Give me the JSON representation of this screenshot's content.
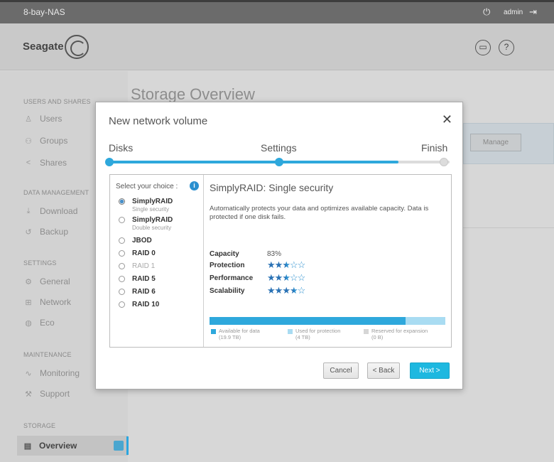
{
  "topbar": {
    "device_name": "8-bay-NAS",
    "user": "admin"
  },
  "header": {
    "brand": "Seagate"
  },
  "sidebar": {
    "sections": [
      {
        "title": "USERS AND SHARES",
        "items": [
          {
            "label": "Users",
            "icon": "user-icon"
          },
          {
            "label": "Groups",
            "icon": "group-icon"
          },
          {
            "label": "Shares",
            "icon": "share-icon"
          }
        ]
      },
      {
        "title": "DATA MANAGEMENT",
        "items": [
          {
            "label": "Download",
            "icon": "download-icon"
          },
          {
            "label": "Backup",
            "icon": "backup-icon"
          }
        ]
      },
      {
        "title": "SETTINGS",
        "items": [
          {
            "label": "General",
            "icon": "gear-icon"
          },
          {
            "label": "Network",
            "icon": "network-icon"
          },
          {
            "label": "Eco",
            "icon": "eco-icon"
          }
        ]
      },
      {
        "title": "MAINTENANCE",
        "items": [
          {
            "label": "Monitoring",
            "icon": "monitoring-icon"
          },
          {
            "label": "Support",
            "icon": "wrench-icon"
          }
        ]
      },
      {
        "title": "STORAGE",
        "items": [
          {
            "label": "Overview",
            "icon": "storage-icon",
            "active": true
          }
        ]
      }
    ]
  },
  "main": {
    "title": "Storage Overview",
    "manage_label": "Manage"
  },
  "modal": {
    "title": "New network volume",
    "steps": [
      "Disks",
      "Settings",
      "Finish"
    ],
    "progress_fraction": 0.85,
    "choices_header": "Select your choice :",
    "options": [
      {
        "label": "SimplyRAID",
        "sub": "Single security",
        "selected": true,
        "disabled": false
      },
      {
        "label": "SimplyRAID",
        "sub": "Double security",
        "selected": false,
        "disabled": false
      },
      {
        "label": "JBOD",
        "sub": "",
        "selected": false,
        "disabled": false
      },
      {
        "label": "RAID 0",
        "sub": "",
        "selected": false,
        "disabled": false
      },
      {
        "label": "RAID 1",
        "sub": "",
        "selected": false,
        "disabled": true
      },
      {
        "label": "RAID 5",
        "sub": "",
        "selected": false,
        "disabled": false
      },
      {
        "label": "RAID 6",
        "sub": "",
        "selected": false,
        "disabled": false
      },
      {
        "label": "RAID 10",
        "sub": "",
        "selected": false,
        "disabled": false
      }
    ],
    "detail": {
      "title": "SimplyRAID: Single security",
      "description": "Automatically protects your data and optimizes available capacity. Data is protected if one disk fails.",
      "metrics": [
        {
          "label": "Capacity",
          "value": "83%"
        },
        {
          "label": "Protection",
          "stars": 2.5
        },
        {
          "label": "Performance",
          "stars": 2.5
        },
        {
          "label": "Scalability",
          "stars": 3.5
        }
      ],
      "capacity_used_fraction": 0.83,
      "legend": [
        {
          "label": "Available for data",
          "value": "(19.9 TB)",
          "color": "#2ea8dc"
        },
        {
          "label": "Used for protection",
          "value": "(4 TB)",
          "color": "#a9dcf2"
        },
        {
          "label": "Reserved for expansion",
          "value": "(0 B)",
          "color": "#d6d6d6"
        }
      ]
    },
    "buttons": {
      "cancel": "Cancel",
      "back": "< Back",
      "next": "Next >"
    }
  }
}
